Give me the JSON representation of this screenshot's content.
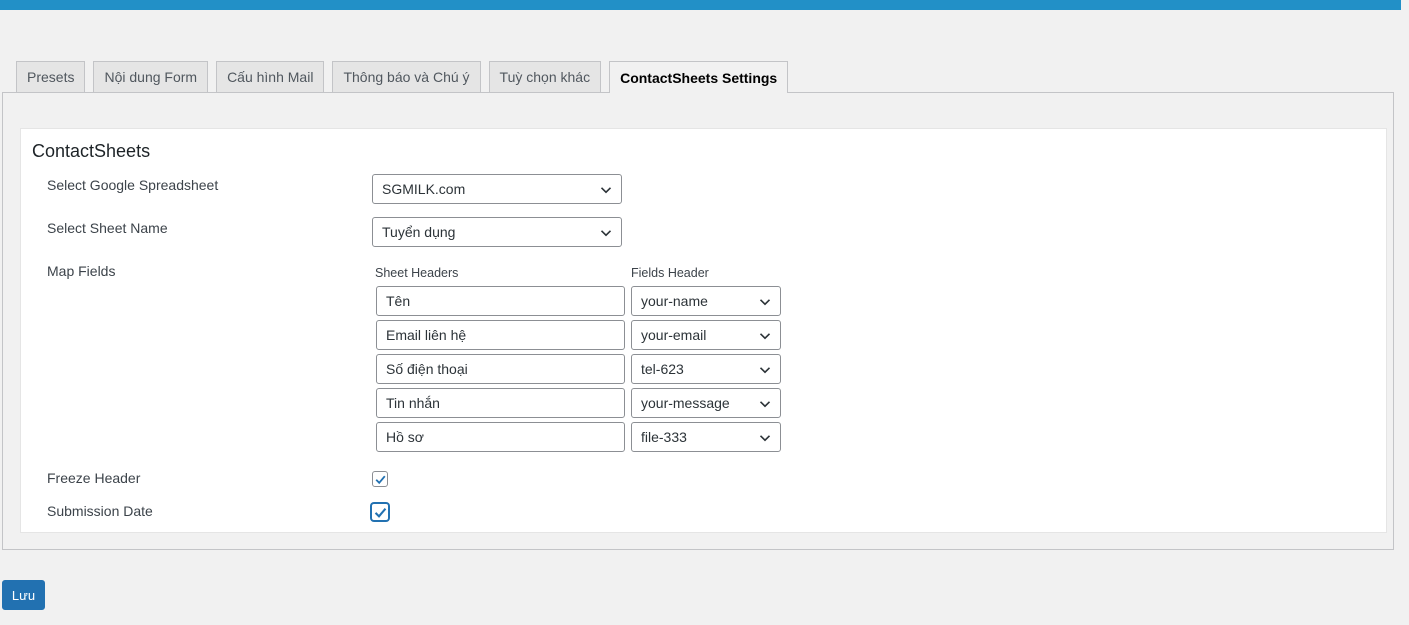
{
  "tabs": [
    {
      "label": "Presets"
    },
    {
      "label": "Nội dung Form"
    },
    {
      "label": "Cấu hình Mail"
    },
    {
      "label": "Thông báo và Chú ý"
    },
    {
      "label": "Tuỳ chọn khác"
    },
    {
      "label": "ContactSheets Settings",
      "active": true
    }
  ],
  "panel": {
    "title": "ContactSheets",
    "spreadsheet": {
      "label": "Select Google Spreadsheet",
      "value": "SGMILK.com"
    },
    "sheet": {
      "label": "Select Sheet Name",
      "value": "Tuyển dụng"
    },
    "map_fields": {
      "label": "Map Fields",
      "sheet_headers_label": "Sheet Headers",
      "fields_header_label": "Fields Header",
      "rows": [
        {
          "header": "Tên",
          "field": "your-name"
        },
        {
          "header": "Email liên hệ",
          "field": "your-email"
        },
        {
          "header": "Số điện thoại",
          "field": "tel-623"
        },
        {
          "header": "Tin nhắn",
          "field": "your-message"
        },
        {
          "header": "Hồ sơ",
          "field": "file-333"
        }
      ]
    },
    "freeze_header": {
      "label": "Freeze Header",
      "checked": true
    },
    "submission_date": {
      "label": "Submission Date",
      "checked": true
    }
  },
  "save_label": "Lưu",
  "colors": {
    "accent": "#2271b1",
    "top_bar": "#2290c7"
  },
  "icons": {
    "dropdown": "chevron-down-icon",
    "check": "check-icon"
  }
}
